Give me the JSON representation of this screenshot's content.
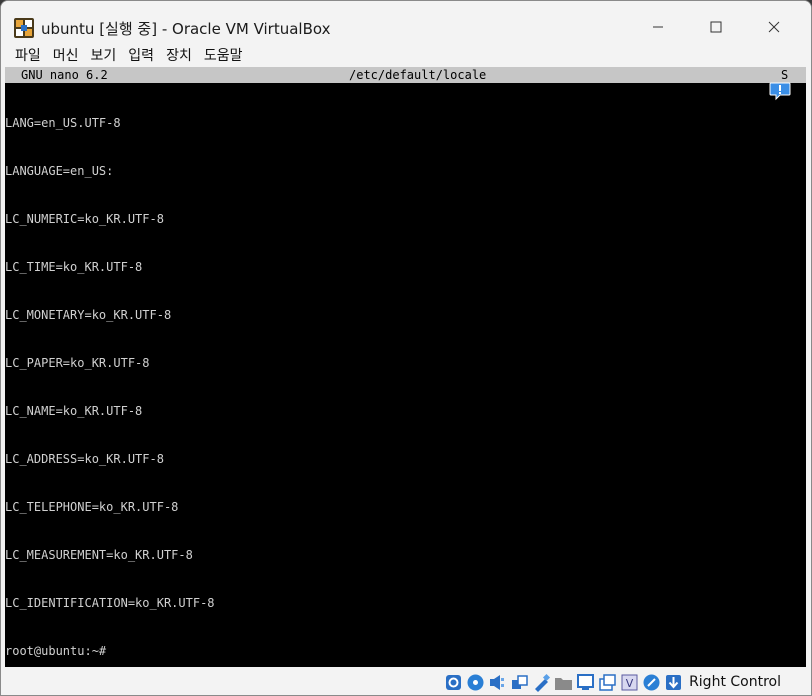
{
  "window": {
    "title": "ubuntu [실행 중] - Oracle VM VirtualBox"
  },
  "menu": {
    "items": [
      "파일",
      "머신",
      "보기",
      "입력",
      "장치",
      "도움말"
    ]
  },
  "nano": {
    "version": "GNU nano 6.2",
    "filename": "/etc/default/locale",
    "flag": "S"
  },
  "file_lines": [
    "LANG=en_US.UTF-8",
    "LANGUAGE=en_US:",
    "LC_NUMERIC=ko_KR.UTF-8",
    "LC_TIME=ko_KR.UTF-8",
    "LC_MONETARY=ko_KR.UTF-8",
    "LC_PAPER=ko_KR.UTF-8",
    "LC_NAME=ko_KR.UTF-8",
    "LC_ADDRESS=ko_KR.UTF-8",
    "LC_TELEPHONE=ko_KR.UTF-8",
    "LC_MEASUREMENT=ko_KR.UTF-8",
    "LC_IDENTIFICATION=ko_KR.UTF-8"
  ],
  "prompt": "root@ubuntu:~#",
  "statusbar": {
    "host_key_label": "Right Control",
    "icons": [
      "hard-disk-icon",
      "optical-drive-icon",
      "audio-icon",
      "network-icon",
      "usb-icon",
      "shared-folders-icon",
      "display-icon",
      "recording-icon",
      "virtualization-icon",
      "mouse-integration-icon",
      "keyboard-capture-icon"
    ]
  },
  "colors": {
    "console_bg": "#000000",
    "console_text": "#d0d0d0",
    "nano_bar_bg": "#c6c6c6",
    "chrome_bg": "#f3f3f3",
    "vbox_blue": "#1f6fc5"
  }
}
